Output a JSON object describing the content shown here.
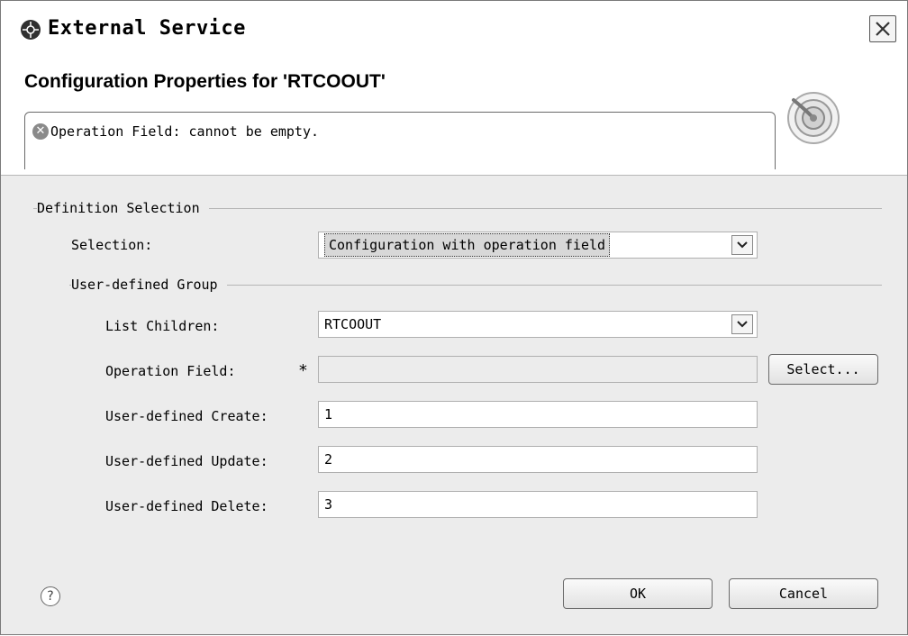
{
  "window": {
    "title": "External Service"
  },
  "header": {
    "title": "Configuration Properties for 'RTCOOUT'",
    "message": "Operation Field: cannot be empty."
  },
  "definition_group": {
    "label": "Definition Selection",
    "selection_label": "Selection:",
    "selection_value": "Configuration with operation field"
  },
  "user_group": {
    "label": "User-defined Group",
    "list_children_label": "List Children:",
    "list_children_value": "RTCOOUT",
    "operation_field_label": "Operation Field:",
    "operation_field_required": "*",
    "operation_field_value": "",
    "select_button": "Select...",
    "create_label": "User-defined Create:",
    "create_value": "1",
    "update_label": "User-defined Update:",
    "update_value": "2",
    "delete_label": "User-defined Delete:",
    "delete_value": "3"
  },
  "footer": {
    "help_icon": "?",
    "ok_button": "OK",
    "cancel_button": "Cancel"
  }
}
